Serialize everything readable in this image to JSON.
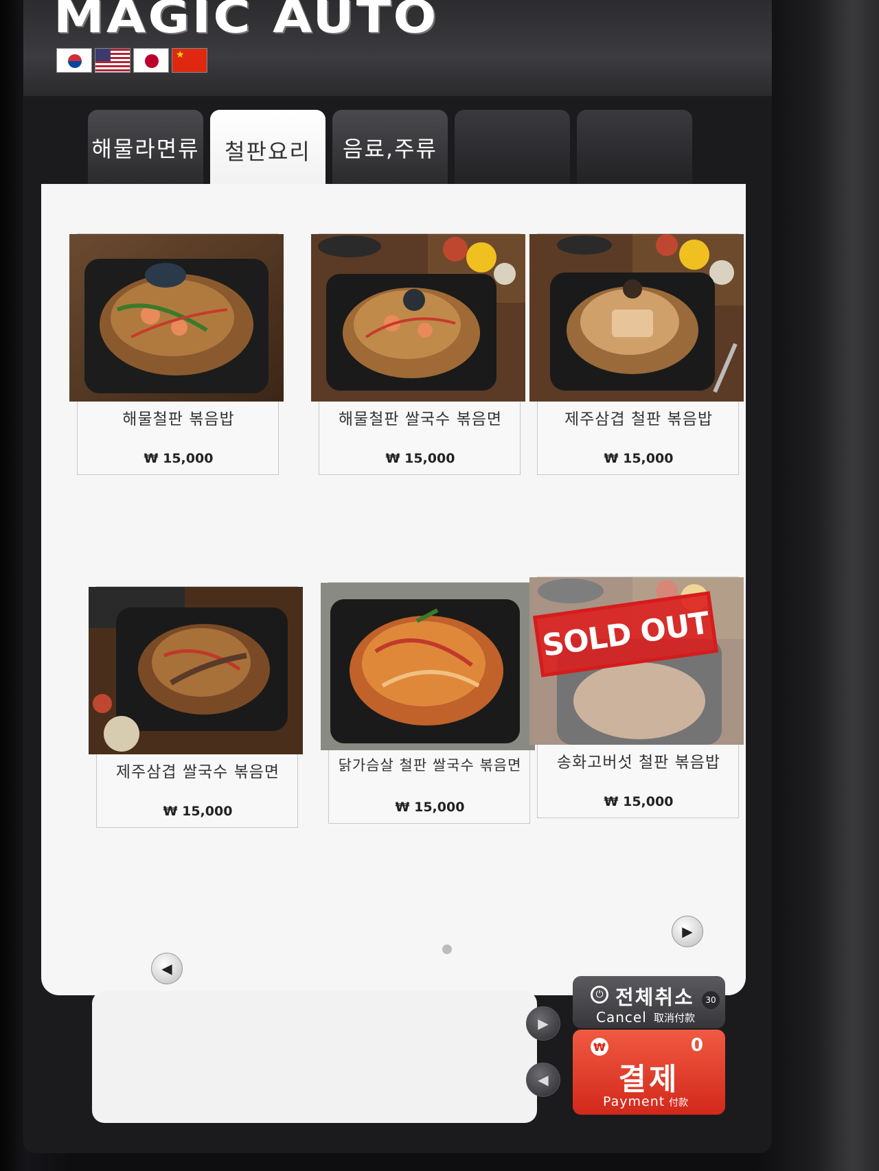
{
  "header": {
    "brand": "MAGIC AUTO",
    "languages": [
      "kr-flag-icon",
      "us-flag-icon",
      "jp-flag-icon",
      "cn-flag-icon"
    ]
  },
  "tabs": [
    {
      "label": "해물라면류",
      "active": false
    },
    {
      "label": "철판요리",
      "active": true
    },
    {
      "label": "음료,주류",
      "active": false
    },
    {
      "label": "",
      "active": false
    },
    {
      "label": "",
      "active": false
    }
  ],
  "menu": {
    "items": [
      {
        "name": "해물철판 볶음밥",
        "price": "₩ 15,000",
        "sold_out": false
      },
      {
        "name": "해물철판 쌀국수 볶음면",
        "price": "₩ 15,000",
        "sold_out": false
      },
      {
        "name": "제주삼겹 철판 볶음밥",
        "price": "₩ 15,000",
        "sold_out": false
      },
      {
        "name": "제주삼겹 쌀국수 볶음면",
        "price": "₩ 15,000",
        "sold_out": false
      },
      {
        "name": "닭가슴살 철판 쌀국수 볶음면",
        "price": "₩ 15,000",
        "sold_out": false
      },
      {
        "name": "송화고버섯 철판 볶음밥",
        "price": "₩ 15,000",
        "sold_out": true
      }
    ],
    "sold_out_label": "SOLD OUT"
  },
  "actions": {
    "cancel": {
      "label": "전체취소",
      "sub_en": "Cancel",
      "sub_cn": "取消付款",
      "timer": "30"
    },
    "pay": {
      "label": "결제",
      "sub_en": "Payment",
      "sub_cn": "付款",
      "count": "0",
      "currency_icon": "₩"
    }
  },
  "colors": {
    "pay_red": "#d2281b",
    "sold_out_red": "#d51c1c",
    "panel_bg": "#f6f6f6"
  }
}
